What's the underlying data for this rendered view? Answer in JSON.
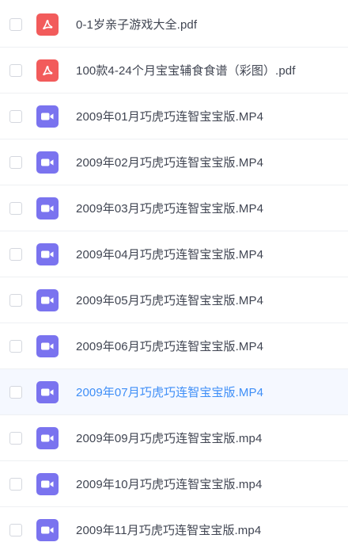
{
  "file_list": {
    "colors": {
      "pdf_icon": "#f25b5b",
      "video_icon": "#7a73ef",
      "hover_text": "#3e8ef7",
      "hover_row_bg": "#f5f8ff",
      "text": "#404552"
    },
    "items": [
      {
        "name": "0-1岁亲子游戏大全.pdf",
        "type": "pdf",
        "icon": "pdf-icon",
        "checked": false,
        "hovered": false
      },
      {
        "name": "100款4-24个月宝宝辅食食谱（彩图）.pdf",
        "type": "pdf",
        "icon": "pdf-icon",
        "checked": false,
        "hovered": false
      },
      {
        "name": "2009年01月巧虎巧连智宝宝版.MP4",
        "type": "video",
        "icon": "video-icon",
        "checked": false,
        "hovered": false
      },
      {
        "name": "2009年02月巧虎巧连智宝宝版.MP4",
        "type": "video",
        "icon": "video-icon",
        "checked": false,
        "hovered": false
      },
      {
        "name": "2009年03月巧虎巧连智宝宝版.MP4",
        "type": "video",
        "icon": "video-icon",
        "checked": false,
        "hovered": false
      },
      {
        "name": "2009年04月巧虎巧连智宝宝版.MP4",
        "type": "video",
        "icon": "video-icon",
        "checked": false,
        "hovered": false
      },
      {
        "name": "2009年05月巧虎巧连智宝宝版.MP4",
        "type": "video",
        "icon": "video-icon",
        "checked": false,
        "hovered": false
      },
      {
        "name": "2009年06月巧虎巧连智宝宝版.MP4",
        "type": "video",
        "icon": "video-icon",
        "checked": false,
        "hovered": false
      },
      {
        "name": "2009年07月巧虎巧连智宝宝版.MP4",
        "type": "video",
        "icon": "video-icon",
        "checked": false,
        "hovered": true
      },
      {
        "name": "2009年09月巧虎巧连智宝宝版.mp4",
        "type": "video",
        "icon": "video-icon",
        "checked": false,
        "hovered": false
      },
      {
        "name": "2009年10月巧虎巧连智宝宝版.mp4",
        "type": "video",
        "icon": "video-icon",
        "checked": false,
        "hovered": false
      },
      {
        "name": "2009年11月巧虎巧连智宝宝版.mp4",
        "type": "video",
        "icon": "video-icon",
        "checked": false,
        "hovered": false
      }
    ]
  }
}
